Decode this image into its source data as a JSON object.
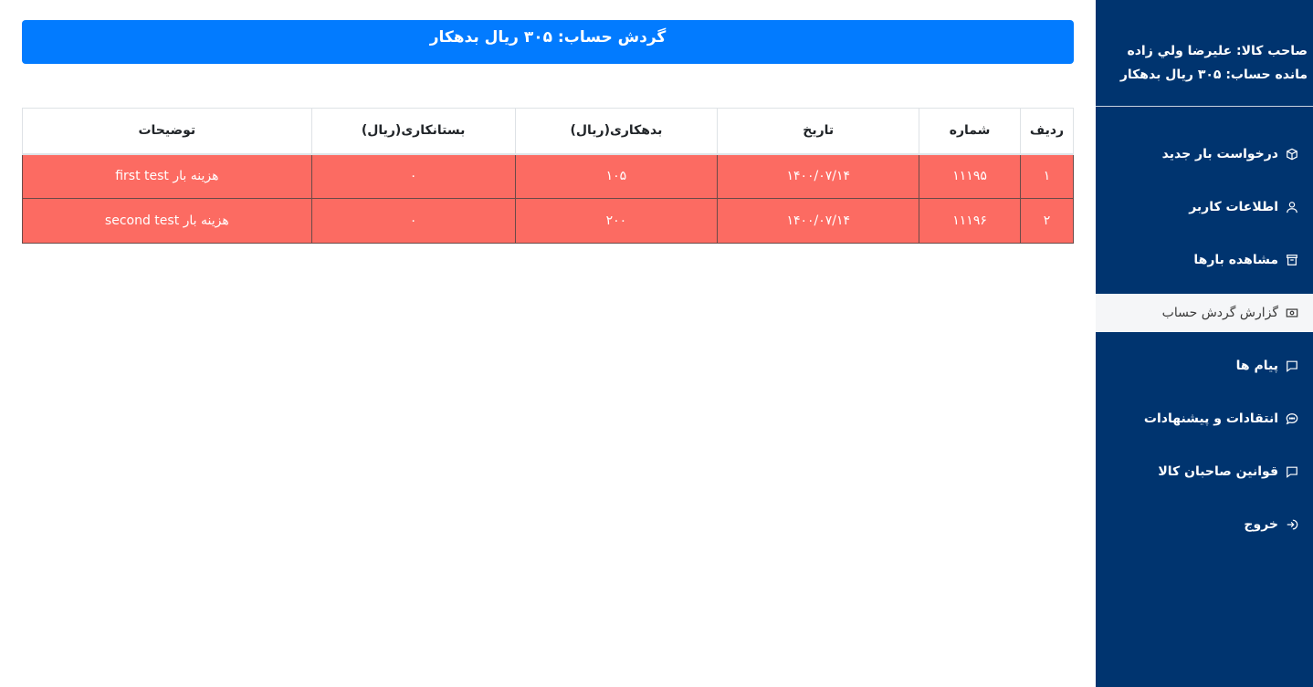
{
  "sidebar": {
    "owner_line": "صاحب کالا: عليرضا ولي زاده",
    "balance_line": "مانده حساب: ۳۰۵ ریال بدهکار",
    "items": [
      {
        "label": "درخواست بار جدید",
        "icon": "package-icon"
      },
      {
        "label": "اطلاعات کاربر",
        "icon": "user-icon"
      },
      {
        "label": "مشاهده بارها",
        "icon": "archive-icon"
      },
      {
        "label": "گزارش گردش حساب",
        "icon": "cash-icon",
        "active": true
      },
      {
        "label": "پیام ها",
        "icon": "message-icon"
      },
      {
        "label": "انتقادات و پیشنهادات",
        "icon": "chat-dots-icon"
      },
      {
        "label": "قوانین صاحبان کالا",
        "icon": "message-icon"
      },
      {
        "label": "خروج",
        "icon": "logout-icon"
      }
    ]
  },
  "main": {
    "banner_title": "گردش حساب:  ۳۰۵ ریال بدهکار",
    "table": {
      "headers": [
        "ردیف",
        "شماره",
        "تاریخ",
        "بدهکاری(ریال)",
        "بستانکاری(ریال)",
        "توضیحات"
      ],
      "rows": [
        [
          "۱",
          "۱۱۱۹۵",
          "۱۴۰۰/۰۷/۱۴",
          "۱۰۵",
          "۰",
          "هزینه بار first test"
        ],
        [
          "۲",
          "۱۱۱۹۶",
          "۱۴۰۰/۰۷/۱۴",
          "۲۰۰",
          "۰",
          "هزینه بار second test"
        ]
      ]
    }
  },
  "colors": {
    "sidebar_bg": "#00346f",
    "banner_bg": "#027bff",
    "row_bg": "#fc6b62",
    "active_item_bg": "#f5f6f8"
  }
}
